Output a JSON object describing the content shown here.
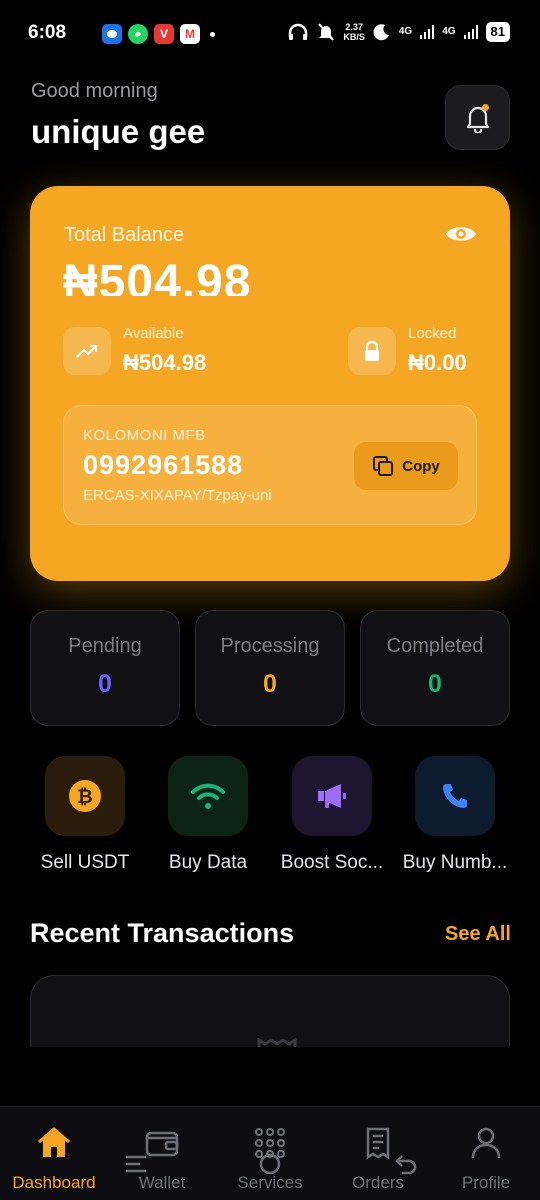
{
  "status_bar": {
    "time": "6:08",
    "speed_value": "2.37",
    "speed_unit": "KB/S",
    "net1": "4G",
    "net2": "4G",
    "battery": "81"
  },
  "header": {
    "greeting": "Good morning",
    "username": "unique gee"
  },
  "balance_card": {
    "label": "Total Balance",
    "amount": "₦504.98",
    "available_label": "Available",
    "available_value": "₦504.98",
    "locked_label": "Locked",
    "locked_value": "₦0.00",
    "bank_name": "KOLOMONI MFB",
    "account_number": "0992961588",
    "account_name": "ERCAS-XIXAPAY/Tzpay-uni",
    "copy_label": "Copy"
  },
  "stats": [
    {
      "label": "Pending",
      "value": "0",
      "color": "#6c63ff"
    },
    {
      "label": "Processing",
      "value": "0",
      "color": "#f5a623"
    },
    {
      "label": "Completed",
      "value": "0",
      "color": "#19b37a"
    }
  ],
  "quick_actions": [
    {
      "label": "Sell USDT",
      "icon": "bitcoin-icon"
    },
    {
      "label": "Buy Data",
      "icon": "wifi-icon"
    },
    {
      "label": "Boost Soc...",
      "icon": "megaphone-icon"
    },
    {
      "label": "Buy Numb...",
      "icon": "phone-icon"
    }
  ],
  "recent": {
    "title": "Recent Transactions",
    "see_all": "See All"
  },
  "nav": [
    {
      "label": "Dashboard",
      "icon": "home-icon",
      "active": true
    },
    {
      "label": "Wallet",
      "icon": "wallet-icon"
    },
    {
      "label": "Services",
      "icon": "grid-icon"
    },
    {
      "label": "Orders",
      "icon": "receipt-icon"
    },
    {
      "label": "Profile",
      "icon": "user-icon"
    }
  ],
  "colors": {
    "accent": "#f5a623",
    "background": "#000000"
  }
}
